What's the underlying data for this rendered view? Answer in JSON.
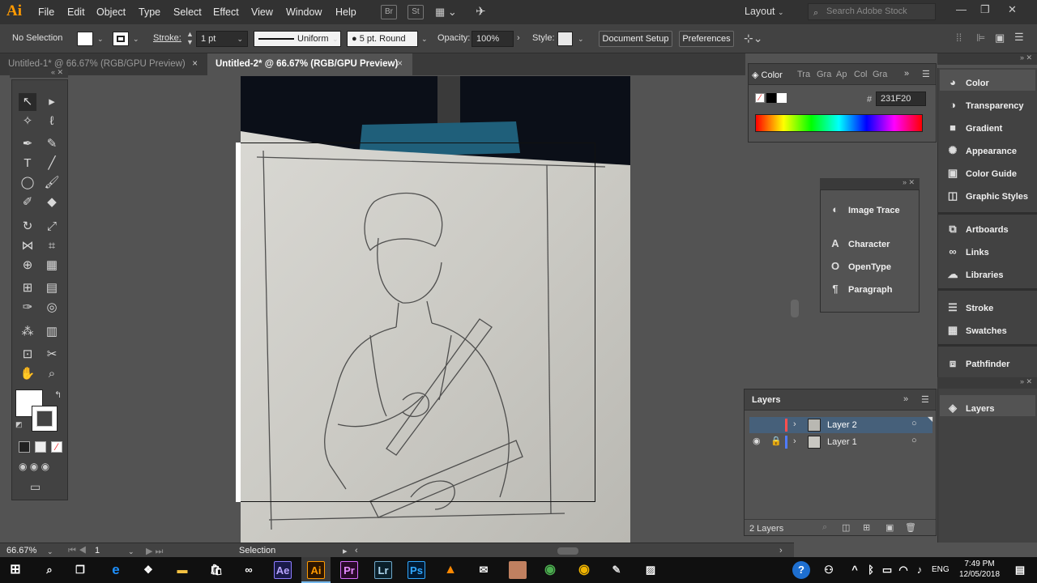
{
  "app": {
    "logo": "Ai"
  },
  "menu": [
    "File",
    "Edit",
    "Object",
    "Type",
    "Select",
    "Effect",
    "View",
    "Window",
    "Help"
  ],
  "menubar_icons": {
    "bridge": "Br",
    "stock": "St"
  },
  "workspace": {
    "label": "Layout"
  },
  "search": {
    "placeholder": "Search Adobe Stock"
  },
  "control": {
    "selection": "No Selection",
    "stroke_label": "Stroke:",
    "stroke_weight": "1 pt",
    "stroke_profile": "Uniform",
    "brush": "5 pt. Round",
    "opacity_label": "Opacity:",
    "opacity": "100%",
    "style_label": "Style:",
    "doc_setup": "Document Setup",
    "preferences": "Preferences"
  },
  "tabs": [
    {
      "label": "Untitled-1* @ 66.67% (RGB/GPU Preview)",
      "close": "×"
    },
    {
      "label": "Untitled-2* @ 66.67% (RGB/GPU Preview)",
      "close": "×"
    }
  ],
  "color_panel": {
    "tabs": [
      "Color",
      "Tra",
      "Gra",
      "Ap",
      "Col",
      "Gra"
    ],
    "hash": "#",
    "hex": "231F20"
  },
  "dock": [
    {
      "label": "Color",
      "icon": "color-icon"
    },
    {
      "label": "Transparency",
      "icon": "transparency-icon"
    },
    {
      "label": "Gradient",
      "icon": "gradient-icon"
    },
    {
      "label": "Appearance",
      "icon": "appearance-icon"
    },
    {
      "label": "Color Guide",
      "icon": "color-guide-icon"
    },
    {
      "label": "Graphic Styles",
      "icon": "graphic-styles-icon"
    },
    {
      "label": "Artboards",
      "icon": "artboards-icon"
    },
    {
      "label": "Links",
      "icon": "links-icon"
    },
    {
      "label": "Libraries",
      "icon": "libraries-icon"
    },
    {
      "label": "Stroke",
      "icon": "stroke-icon"
    },
    {
      "label": "Swatches",
      "icon": "swatches-icon"
    },
    {
      "label": "Pathfinder",
      "icon": "pathfinder-icon"
    },
    {
      "label": "Layers",
      "icon": "layers-icon"
    }
  ],
  "float_panel": [
    "Image Trace",
    "Character",
    "OpenType",
    "Paragraph"
  ],
  "layers": {
    "title": "Layers",
    "items": [
      {
        "name": "Layer 2",
        "color": "#ff4f4f"
      },
      {
        "name": "Layer 1",
        "color": "#4f7bff"
      }
    ],
    "count": "2 Layers"
  },
  "status": {
    "zoom": "66.67%",
    "page": "1",
    "tool": "Selection"
  },
  "taskbar": {
    "apps": [
      "Ae",
      "Ai",
      "Pr",
      "Lr",
      "Ps"
    ],
    "lang": "ENG",
    "time": "7:49 PM",
    "date": "12/05/2018"
  },
  "colors": {
    "accent": "#ff9a00",
    "panel": "#535353",
    "dark": "#323232"
  }
}
